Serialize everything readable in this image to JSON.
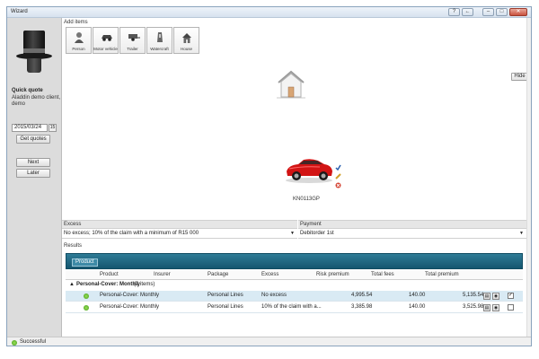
{
  "window": {
    "title": "Wizard"
  },
  "sidebar": {
    "title": "Quick quote",
    "subtitle": "Aladdin demo client, demo",
    "date": "2015/03/24",
    "get_quotes": "Get quotes",
    "next": "Next",
    "later": "Later"
  },
  "add_items": {
    "label": "Add items",
    "items": [
      {
        "label": "Person",
        "icon": "person-icon"
      },
      {
        "label": "Motor vehicle",
        "icon": "car-icon"
      },
      {
        "label": "Trailer",
        "icon": "trailer-icon"
      },
      {
        "label": "Watercraft",
        "icon": "watercraft-icon"
      },
      {
        "label": "House",
        "icon": "house-icon"
      }
    ]
  },
  "hide_label": "Hide",
  "vehicle_label": "KN0113GP",
  "excess": {
    "label": "Excess",
    "value": "No excess; 10% of the claim with a minimum of R15 000"
  },
  "payment": {
    "label": "Payment",
    "value": "Debitorder 1st"
  },
  "results": {
    "label": "Results",
    "tab": "Product",
    "columns": [
      "Product",
      "Insurer",
      "Package",
      "Excess",
      "Risk premium",
      "Total fees",
      "Total premium"
    ],
    "group": "Personal-Cover: Monthly",
    "group_count": "(2 items)",
    "rows": [
      {
        "product": "Personal-Cover: Monthly",
        "insurer": "",
        "package": "Personal Lines",
        "excess": "No excess",
        "risk": "4,995.54",
        "fees": "140.00",
        "total": "5,135.54",
        "checked": true
      },
      {
        "product": "Personal-Cover: Monthly",
        "insurer": "",
        "package": "Personal Lines",
        "excess": "10% of the claim with a...",
        "risk": "3,385.98",
        "fees": "140.00",
        "total": "3,525.98",
        "checked": false
      }
    ]
  },
  "status": "Successful"
}
